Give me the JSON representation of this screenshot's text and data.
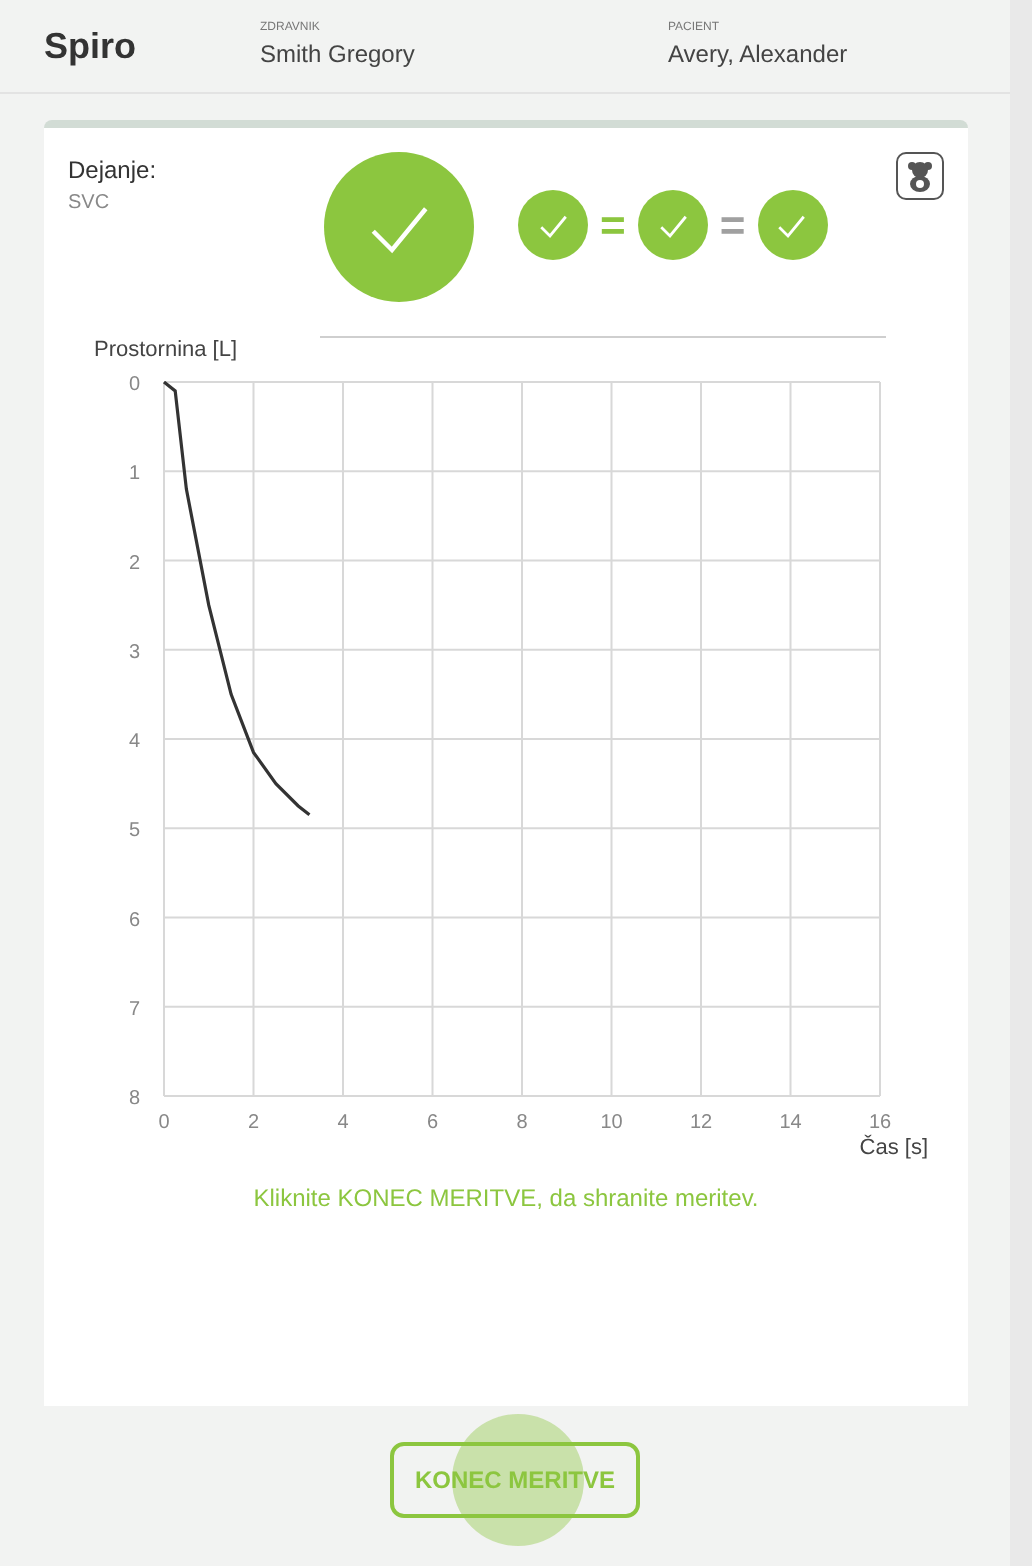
{
  "header": {
    "app_title": "Spiro",
    "doctor": {
      "label": "ZDRAVNIK",
      "value": "Smith Gregory"
    },
    "patient": {
      "label": "PACIENT",
      "value": "Avery, Alexander"
    }
  },
  "card": {
    "action_label": "Dejanje:",
    "action_value": "SVC",
    "result": {
      "passed": true
    },
    "attempts": [
      {
        "passed": true
      },
      {
        "passed": true
      },
      {
        "passed": true
      }
    ],
    "separators": [
      {
        "text": "=",
        "highlighted": true
      },
      {
        "text": "=",
        "highlighted": false
      }
    ],
    "chart": {
      "chart_data": {
        "type": "line",
        "ylabel": "Prostornina [L]",
        "xlabel": "Čas [s]",
        "xlim": [
          0,
          16
        ],
        "ylim": [
          8,
          0
        ],
        "grid": true,
        "xticks": [
          0,
          2,
          4,
          6,
          8,
          10,
          12,
          14,
          16
        ],
        "yticks": [
          0,
          1,
          2,
          3,
          4,
          5,
          6,
          7,
          8
        ],
        "x": [
          0,
          0.25,
          0.5,
          1,
          1.5,
          2,
          2.5,
          3,
          3.25
        ],
        "series": [
          {
            "color": "#333333",
            "values": [
              0,
              0.1,
              1.2,
              2.5,
              3.5,
              4.15,
              4.5,
              4.75,
              4.85
            ]
          }
        ]
      }
    },
    "hint": "Kliknite KONEC MERITVE, da shranite meritev."
  },
  "end_button": {
    "label": "KONEC MERITVE"
  }
}
